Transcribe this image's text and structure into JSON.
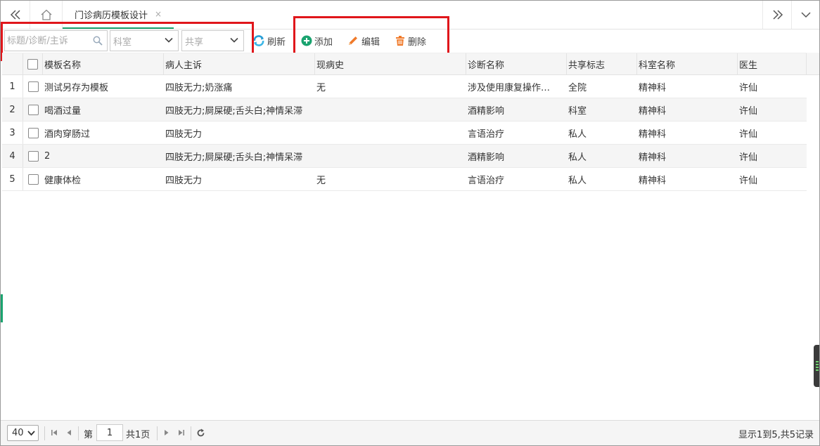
{
  "tabbar": {
    "active_tab_label": "门诊病历模板设计",
    "close_glyph": "×"
  },
  "toolbar": {
    "search_placeholder": "标题/诊断/主诉",
    "dept_select_placeholder": "科室",
    "share_select_placeholder": "共享",
    "refresh_label": "刷新",
    "add_label": "添加",
    "edit_label": "编辑",
    "delete_label": "删除"
  },
  "table": {
    "columns": [
      "模板名称",
      "病人主诉",
      "现病史",
      "诊断名称",
      "共享标志",
      "科室名称",
      "医生"
    ],
    "rows": [
      {
        "num": "1",
        "name": "测试另存为模板",
        "complaint": "四肢无力;奶涨痛",
        "history": "无",
        "diagnosis": "涉及使用康复操作…",
        "share": "全院",
        "dept": "精神科",
        "doctor": "许仙"
      },
      {
        "num": "2",
        "name": "喝酒过量",
        "complaint": "四肢无力;屙屎硬;舌头白;神情呆滞",
        "history": "",
        "diagnosis": "酒精影响",
        "share": "科室",
        "dept": "精神科",
        "doctor": "许仙"
      },
      {
        "num": "3",
        "name": "酒肉穿肠过",
        "complaint": "四肢无力",
        "history": "",
        "diagnosis": "言语治疗",
        "share": "私人",
        "dept": "精神科",
        "doctor": "许仙"
      },
      {
        "num": "4",
        "name": "2",
        "complaint": "四肢无力;屙屎硬;舌头白;神情呆滞",
        "history": "",
        "diagnosis": "酒精影响",
        "share": "私人",
        "dept": "精神科",
        "doctor": "许仙"
      },
      {
        "num": "5",
        "name": "健康体检",
        "complaint": "四肢无力",
        "history": "无",
        "diagnosis": "言语治疗",
        "share": "私人",
        "dept": "精神科",
        "doctor": "许仙"
      }
    ]
  },
  "footer": {
    "page_size": "40",
    "page_prefix": "第",
    "current_page": "1",
    "page_total": "共1页",
    "summary": "显示1到5,共5记录"
  },
  "colors": {
    "accent": "#1aa36f",
    "highlight_box": "#e0161b",
    "add_icon": "#1aa36f",
    "edit_icon": "#f07a2a",
    "delete_icon": "#f07a2a",
    "refresh_icon": "#2a9fd6"
  }
}
